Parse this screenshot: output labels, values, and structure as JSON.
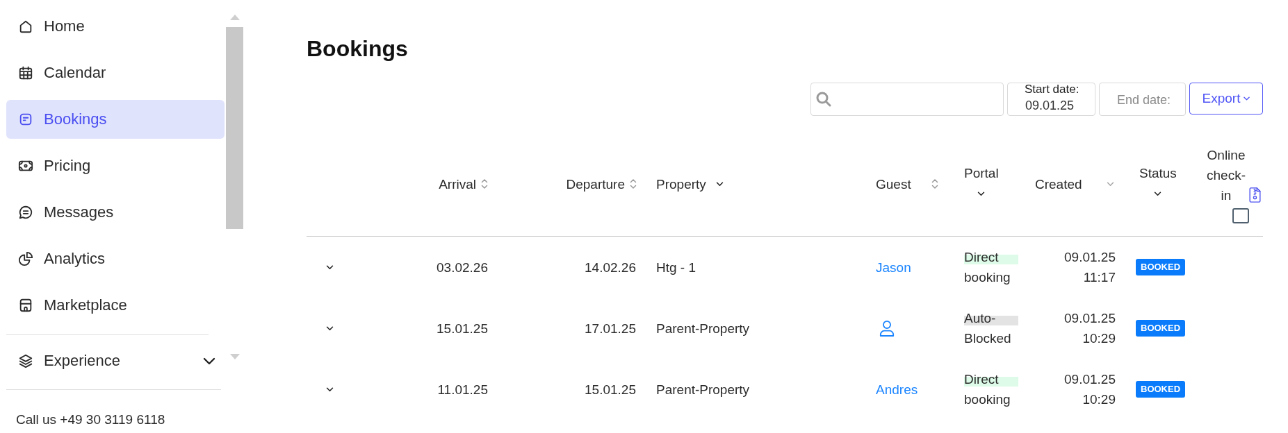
{
  "sidebar": {
    "items": [
      {
        "label": "Home",
        "selected": false
      },
      {
        "label": "Calendar",
        "selected": false
      },
      {
        "label": "Bookings",
        "selected": true
      },
      {
        "label": "Pricing",
        "selected": false
      },
      {
        "label": "Messages",
        "selected": false
      },
      {
        "label": "Analytics",
        "selected": false
      },
      {
        "label": "Marketplace",
        "selected": false
      }
    ],
    "group": {
      "label": "Experience",
      "expanded": false
    },
    "contact": "Call us +49 30 3119 6118"
  },
  "page": {
    "title": "Bookings"
  },
  "toolbar": {
    "start_date": {
      "label": "Start date:",
      "value": "09.01.25"
    },
    "end_date": {
      "placeholder": "End date:"
    },
    "export_button": "Export"
  },
  "table": {
    "columns": [
      {
        "label": "Arrival",
        "kind": "sort"
      },
      {
        "label": "Departure",
        "kind": "sort"
      },
      {
        "label": "Property",
        "kind": "filter"
      },
      {
        "label": "Guest",
        "kind": "sort"
      },
      {
        "label": "Portal",
        "kind": "filter"
      },
      {
        "label": "Created",
        "kind": "sorted"
      },
      {
        "label": "Status",
        "kind": "filter"
      },
      {
        "label": "Online check-in",
        "kind": "select_all",
        "checked": false
      }
    ],
    "rows": [
      {
        "expanded": false,
        "arrival": "03.02.26",
        "departure": "14.02.26",
        "property": "Htg - 1",
        "guest": {
          "kind": "name",
          "name": "Jason"
        },
        "portal": {
          "label": "Direct booking",
          "color": "#ddfbe8"
        },
        "created": "09.01.25 11:17",
        "status": "BOOKED"
      },
      {
        "expanded": false,
        "arrival": "15.01.25",
        "departure": "17.01.25",
        "property": "Parent-Property",
        "guest": {
          "kind": "icon"
        },
        "portal": {
          "label": "Auto-Blocked",
          "color": "#e3e3e3"
        },
        "created": "09.01.25 10:29",
        "status": "BOOKED"
      },
      {
        "expanded": false,
        "arrival": "11.01.25",
        "departure": "15.01.25",
        "property": "Parent-Property",
        "guest": {
          "kind": "name",
          "name": "Andres"
        },
        "portal": {
          "label": "Direct booking",
          "color": "#ddfbe8"
        },
        "created": "09.01.25 10:29",
        "status": "BOOKED"
      }
    ]
  }
}
